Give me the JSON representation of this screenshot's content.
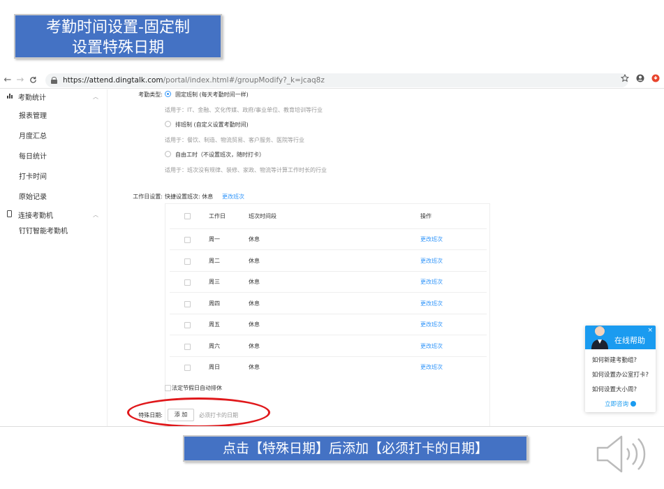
{
  "title": {
    "line1": "考勤时间设置-固定制",
    "line2": "设置特殊日期"
  },
  "browser": {
    "url_host": "https://attend.dingtalk.com",
    "url_rest": "/portal/index.html#/groupModify?_k=jcaq8z"
  },
  "sidebar": {
    "group1": "考勤统计",
    "items1": [
      "报表管理",
      "月度汇总",
      "每日统计",
      "打卡时间",
      "原始记录"
    ],
    "group2": "连接考勤机",
    "items2": [
      "钉钉智能考勤机"
    ]
  },
  "form": {
    "type_label": "考勤类型:",
    "opt1": "固定班制 (每天考勤时间一样)",
    "opt1_desc": "适用于：IT、金融、文化传媒、政府/事业单位、教育培训等行业",
    "opt2": "排班制 (自定义设置考勤时间)",
    "opt2_desc": "适用于：餐饮、制造、物流贸易、客户服务、医院等行业",
    "opt3": "自由工时（不设置班次，随时打卡）",
    "opt3_desc": "适用于：班次没有规律、装修、家政、物流等计算工作时长的行业",
    "workday_label": "工作日设置:",
    "quick_set": "快捷设置班次: 休息",
    "change_shift": "更改班次",
    "holiday": "法定节假日自动排休",
    "special_label": "特殊日期:",
    "add_btn": "添 加",
    "must_clock": "必须打卡的日期"
  },
  "table": {
    "headers": [
      "工作日",
      "班次时间段",
      "操作"
    ],
    "rows": [
      {
        "day": "周一",
        "shift": "休息",
        "op": "更改班次"
      },
      {
        "day": "周二",
        "shift": "休息",
        "op": "更改班次"
      },
      {
        "day": "周三",
        "shift": "休息",
        "op": "更改班次"
      },
      {
        "day": "周四",
        "shift": "休息",
        "op": "更改班次"
      },
      {
        "day": "周五",
        "shift": "休息",
        "op": "更改班次"
      },
      {
        "day": "周六",
        "shift": "休息",
        "op": "更改班次"
      },
      {
        "day": "周日",
        "shift": "休息",
        "op": "更改班次"
      }
    ]
  },
  "help": {
    "title": "在线帮助",
    "close": "×",
    "questions": [
      "如何新建考勤组?",
      "如何设置办公室打卡?",
      "如何设置大小周?"
    ],
    "cta": "立即咨询"
  },
  "caption": "点击【特殊日期】后添加【必须打卡的日期】",
  "colors": {
    "accent": "#3296fa",
    "banner": "#4472c4",
    "highlight": "#e0181b"
  }
}
